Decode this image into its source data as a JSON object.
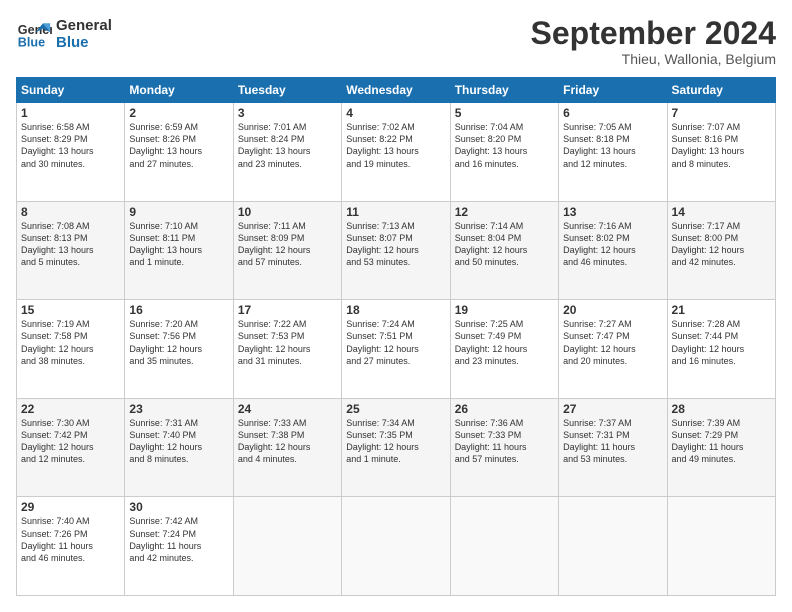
{
  "header": {
    "logo_line1": "General",
    "logo_line2": "Blue",
    "month": "September 2024",
    "location": "Thieu, Wallonia, Belgium"
  },
  "days_of_week": [
    "Sunday",
    "Monday",
    "Tuesday",
    "Wednesday",
    "Thursday",
    "Friday",
    "Saturday"
  ],
  "weeks": [
    [
      {
        "day": "1",
        "info": "Sunrise: 6:58 AM\nSunset: 8:29 PM\nDaylight: 13 hours\nand 30 minutes."
      },
      {
        "day": "2",
        "info": "Sunrise: 6:59 AM\nSunset: 8:26 PM\nDaylight: 13 hours\nand 27 minutes."
      },
      {
        "day": "3",
        "info": "Sunrise: 7:01 AM\nSunset: 8:24 PM\nDaylight: 13 hours\nand 23 minutes."
      },
      {
        "day": "4",
        "info": "Sunrise: 7:02 AM\nSunset: 8:22 PM\nDaylight: 13 hours\nand 19 minutes."
      },
      {
        "day": "5",
        "info": "Sunrise: 7:04 AM\nSunset: 8:20 PM\nDaylight: 13 hours\nand 16 minutes."
      },
      {
        "day": "6",
        "info": "Sunrise: 7:05 AM\nSunset: 8:18 PM\nDaylight: 13 hours\nand 12 minutes."
      },
      {
        "day": "7",
        "info": "Sunrise: 7:07 AM\nSunset: 8:16 PM\nDaylight: 13 hours\nand 8 minutes."
      }
    ],
    [
      {
        "day": "8",
        "info": "Sunrise: 7:08 AM\nSunset: 8:13 PM\nDaylight: 13 hours\nand 5 minutes."
      },
      {
        "day": "9",
        "info": "Sunrise: 7:10 AM\nSunset: 8:11 PM\nDaylight: 13 hours\nand 1 minute."
      },
      {
        "day": "10",
        "info": "Sunrise: 7:11 AM\nSunset: 8:09 PM\nDaylight: 12 hours\nand 57 minutes."
      },
      {
        "day": "11",
        "info": "Sunrise: 7:13 AM\nSunset: 8:07 PM\nDaylight: 12 hours\nand 53 minutes."
      },
      {
        "day": "12",
        "info": "Sunrise: 7:14 AM\nSunset: 8:04 PM\nDaylight: 12 hours\nand 50 minutes."
      },
      {
        "day": "13",
        "info": "Sunrise: 7:16 AM\nSunset: 8:02 PM\nDaylight: 12 hours\nand 46 minutes."
      },
      {
        "day": "14",
        "info": "Sunrise: 7:17 AM\nSunset: 8:00 PM\nDaylight: 12 hours\nand 42 minutes."
      }
    ],
    [
      {
        "day": "15",
        "info": "Sunrise: 7:19 AM\nSunset: 7:58 PM\nDaylight: 12 hours\nand 38 minutes."
      },
      {
        "day": "16",
        "info": "Sunrise: 7:20 AM\nSunset: 7:56 PM\nDaylight: 12 hours\nand 35 minutes."
      },
      {
        "day": "17",
        "info": "Sunrise: 7:22 AM\nSunset: 7:53 PM\nDaylight: 12 hours\nand 31 minutes."
      },
      {
        "day": "18",
        "info": "Sunrise: 7:24 AM\nSunset: 7:51 PM\nDaylight: 12 hours\nand 27 minutes."
      },
      {
        "day": "19",
        "info": "Sunrise: 7:25 AM\nSunset: 7:49 PM\nDaylight: 12 hours\nand 23 minutes."
      },
      {
        "day": "20",
        "info": "Sunrise: 7:27 AM\nSunset: 7:47 PM\nDaylight: 12 hours\nand 20 minutes."
      },
      {
        "day": "21",
        "info": "Sunrise: 7:28 AM\nSunset: 7:44 PM\nDaylight: 12 hours\nand 16 minutes."
      }
    ],
    [
      {
        "day": "22",
        "info": "Sunrise: 7:30 AM\nSunset: 7:42 PM\nDaylight: 12 hours\nand 12 minutes."
      },
      {
        "day": "23",
        "info": "Sunrise: 7:31 AM\nSunset: 7:40 PM\nDaylight: 12 hours\nand 8 minutes."
      },
      {
        "day": "24",
        "info": "Sunrise: 7:33 AM\nSunset: 7:38 PM\nDaylight: 12 hours\nand 4 minutes."
      },
      {
        "day": "25",
        "info": "Sunrise: 7:34 AM\nSunset: 7:35 PM\nDaylight: 12 hours\nand 1 minute."
      },
      {
        "day": "26",
        "info": "Sunrise: 7:36 AM\nSunset: 7:33 PM\nDaylight: 11 hours\nand 57 minutes."
      },
      {
        "day": "27",
        "info": "Sunrise: 7:37 AM\nSunset: 7:31 PM\nDaylight: 11 hours\nand 53 minutes."
      },
      {
        "day": "28",
        "info": "Sunrise: 7:39 AM\nSunset: 7:29 PM\nDaylight: 11 hours\nand 49 minutes."
      }
    ],
    [
      {
        "day": "29",
        "info": "Sunrise: 7:40 AM\nSunset: 7:26 PM\nDaylight: 11 hours\nand 46 minutes."
      },
      {
        "day": "30",
        "info": "Sunrise: 7:42 AM\nSunset: 7:24 PM\nDaylight: 11 hours\nand 42 minutes."
      },
      {
        "day": "",
        "info": ""
      },
      {
        "day": "",
        "info": ""
      },
      {
        "day": "",
        "info": ""
      },
      {
        "day": "",
        "info": ""
      },
      {
        "day": "",
        "info": ""
      }
    ]
  ]
}
